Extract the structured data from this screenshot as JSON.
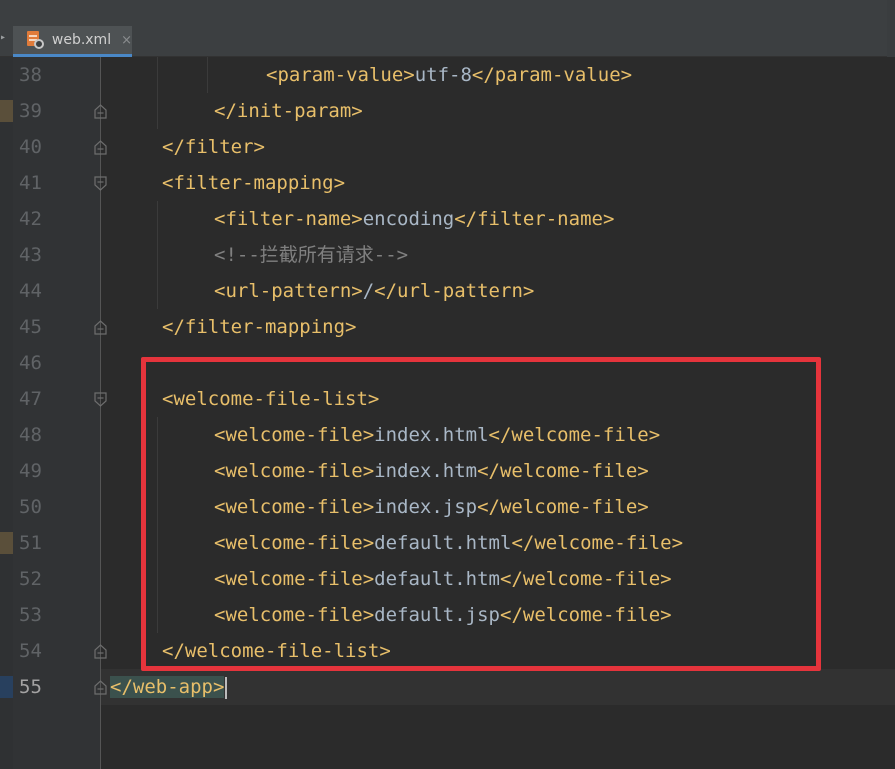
{
  "tab": {
    "label": "web.xml",
    "close": "×",
    "icon": "xml-file-icon"
  },
  "editor": {
    "lines": [
      {
        "num": "38",
        "indent": 3,
        "parts": [
          [
            "tag",
            "<param-value>"
          ],
          [
            "txt",
            "utf-8"
          ],
          [
            "tag",
            "</param-value>"
          ]
        ]
      },
      {
        "num": "39",
        "indent": 2,
        "parts": [
          [
            "tag",
            "</init-param>"
          ]
        ],
        "fold": "end"
      },
      {
        "num": "40",
        "indent": 1,
        "parts": [
          [
            "tag",
            "</filter>"
          ]
        ],
        "fold": "end"
      },
      {
        "num": "41",
        "indent": 1,
        "parts": [
          [
            "tag",
            "<filter-mapping>"
          ]
        ],
        "fold": "start"
      },
      {
        "num": "42",
        "indent": 2,
        "parts": [
          [
            "tag",
            "<filter-name>"
          ],
          [
            "txt",
            "encoding"
          ],
          [
            "tag",
            "</filter-name>"
          ]
        ]
      },
      {
        "num": "43",
        "indent": 2,
        "parts": [
          [
            "cmt",
            "<!--拦截所有请求-->"
          ]
        ]
      },
      {
        "num": "44",
        "indent": 2,
        "parts": [
          [
            "tag",
            "<url-pattern>"
          ],
          [
            "txt",
            "/"
          ],
          [
            "tag",
            "</url-pattern>"
          ]
        ]
      },
      {
        "num": "45",
        "indent": 1,
        "parts": [
          [
            "tag",
            "</filter-mapping>"
          ]
        ],
        "fold": "end"
      },
      {
        "num": "46",
        "indent": 0,
        "parts": []
      },
      {
        "num": "47",
        "indent": 1,
        "parts": [
          [
            "tag",
            "<welcome-file-list>"
          ]
        ],
        "fold": "start"
      },
      {
        "num": "48",
        "indent": 2,
        "parts": [
          [
            "tag",
            "<welcome-file>"
          ],
          [
            "txt",
            "index.html"
          ],
          [
            "tag",
            "</welcome-file>"
          ]
        ]
      },
      {
        "num": "49",
        "indent": 2,
        "parts": [
          [
            "tag",
            "<welcome-file>"
          ],
          [
            "txt",
            "index.htm"
          ],
          [
            "tag",
            "</welcome-file>"
          ]
        ]
      },
      {
        "num": "50",
        "indent": 2,
        "parts": [
          [
            "tag",
            "<welcome-file>"
          ],
          [
            "txt",
            "index.jsp"
          ],
          [
            "tag",
            "</welcome-file>"
          ]
        ]
      },
      {
        "num": "51",
        "indent": 2,
        "parts": [
          [
            "tag",
            "<welcome-file>"
          ],
          [
            "txt",
            "default.html"
          ],
          [
            "tag",
            "</welcome-file>"
          ]
        ]
      },
      {
        "num": "52",
        "indent": 2,
        "parts": [
          [
            "tag",
            "<welcome-file>"
          ],
          [
            "txt",
            "default.htm"
          ],
          [
            "tag",
            "</welcome-file>"
          ]
        ]
      },
      {
        "num": "53",
        "indent": 2,
        "parts": [
          [
            "tag",
            "<welcome-file>"
          ],
          [
            "txt",
            "default.jsp"
          ],
          [
            "tag",
            "</welcome-file>"
          ]
        ]
      },
      {
        "num": "54",
        "indent": 1,
        "parts": [
          [
            "tag",
            "</welcome-file-list>"
          ]
        ],
        "fold": "end"
      },
      {
        "num": "55",
        "indent": 0,
        "parts": [
          [
            "match",
            "</web-app>"
          ]
        ],
        "fold": "end",
        "current": true
      }
    ]
  },
  "colors": {
    "highlight_box": "#e5343c",
    "tag": "#e8bf6a",
    "text": "#a9b7c6",
    "comment": "#808080"
  }
}
